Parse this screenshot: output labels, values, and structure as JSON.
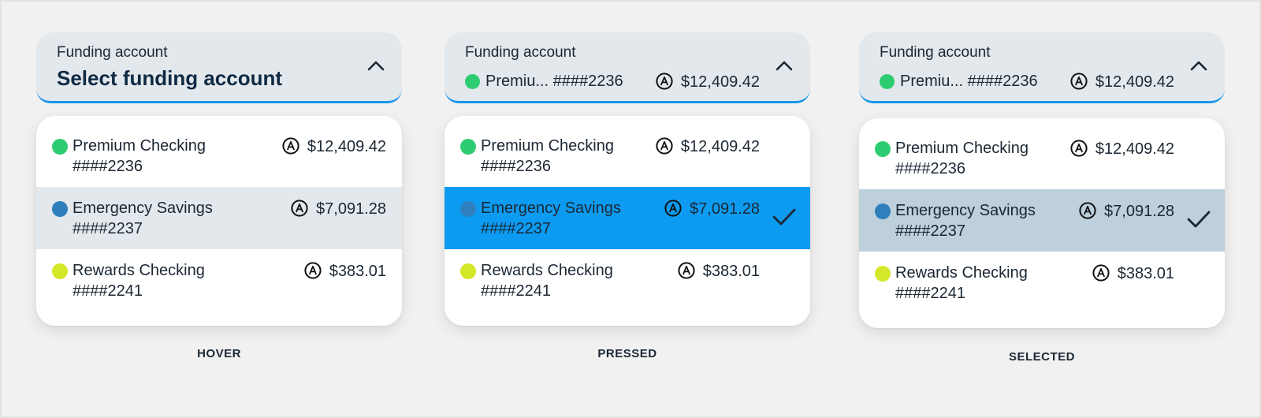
{
  "colors": {
    "background": "#f1f1f1",
    "header_bg": "#e3e8ec",
    "header_underline": "#1a96e8",
    "hover_row": "#e3e8ec",
    "pressed_row": "#0d9bf1",
    "selected_row": "#bdd0dc",
    "dot_premium": "#2ecc71",
    "dot_emergency": "#2f7fbd",
    "dot_rewards": "#d4e82a"
  },
  "accounts": [
    {
      "name": "Premium Checking",
      "number": "####2236",
      "balance": "$12,409.42",
      "dot_icon": "green-dot-icon"
    },
    {
      "name": "Emergency Savings",
      "number": "####2237",
      "balance": "$7,091.28",
      "dot_icon": "blue-dot-icon"
    },
    {
      "name": "Rewards Checking",
      "number": "####2241",
      "balance": "$383.01",
      "dot_icon": "yellow-green-dot-icon"
    }
  ],
  "panels": [
    {
      "state": "HOVER",
      "header": {
        "label": "Funding account",
        "title": "Select funding account"
      },
      "highlighted_index": 1
    },
    {
      "state": "PRESSED",
      "header": {
        "label": "Funding account",
        "selected_name": "Premiu... ####2236",
        "selected_balance": "$12,409.42"
      },
      "highlighted_index": 1,
      "checked_index": 1
    },
    {
      "state": "SELECTED",
      "header": {
        "label": "Funding account",
        "selected_name": "Premiu... ####2236",
        "selected_balance": "$12,409.42"
      },
      "highlighted_index": 1,
      "checked_index": 1
    }
  ],
  "icons": {
    "balance": "a-circle-icon",
    "collapse": "chevron-up-icon",
    "check": "checkmark-icon"
  }
}
